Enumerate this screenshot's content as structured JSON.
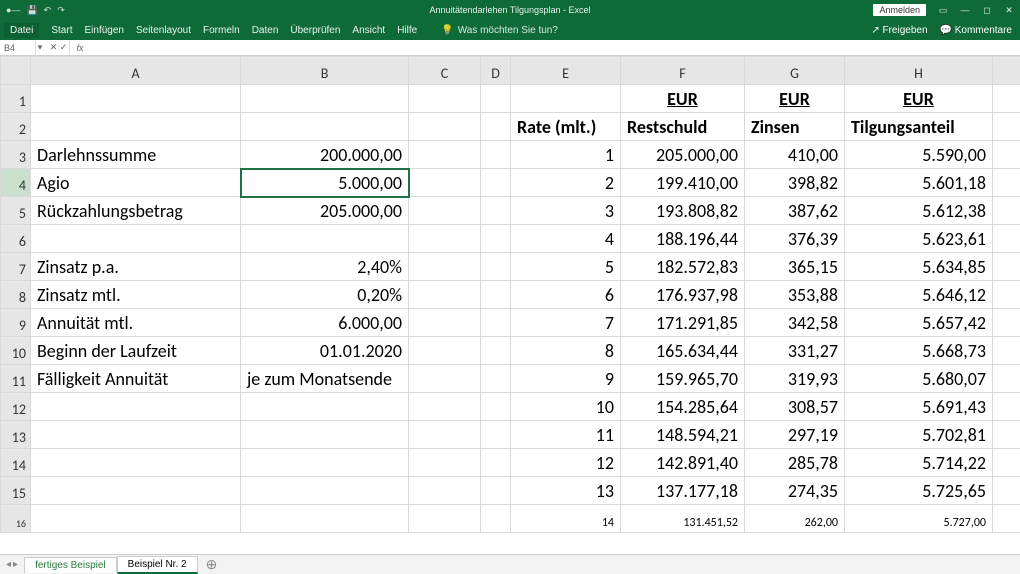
{
  "window": {
    "title": "Annuitätendarlehen Tilgungsplan - Excel",
    "login": "Anmelden",
    "share": "Freigeben",
    "comments": "Kommentare"
  },
  "ribbon": {
    "file": "Datei",
    "tabs": [
      "Start",
      "Einfügen",
      "Seitenlayout",
      "Formeln",
      "Daten",
      "Überprüfen",
      "Ansicht",
      "Hilfe"
    ],
    "tellme_placeholder": "Was möchten Sie tun?"
  },
  "namebox": "B4",
  "columns": [
    "A",
    "B",
    "C",
    "D",
    "E",
    "F",
    "G",
    "H",
    ""
  ],
  "header_row1": {
    "F": "EUR",
    "G": "EUR",
    "H": "EUR"
  },
  "header_row2": {
    "E": "Rate (mlt.)",
    "F": "Restschuld",
    "G": "Zinsen",
    "H": "Tilgungsanteil"
  },
  "left_block": [
    {
      "label": "Darlehnssumme",
      "value": "200.000,00"
    },
    {
      "label": "Agio",
      "value": "5.000,00"
    },
    {
      "label": "Rückzahlungsbetrag",
      "value": "205.000,00"
    },
    {
      "label": "",
      "value": ""
    },
    {
      "label": "Zinsatz p.a.",
      "value": "2,40%"
    },
    {
      "label": "Zinsatz mtl.",
      "value": "0,20%"
    },
    {
      "label": "Annuität mtl.",
      "value": "6.000,00"
    },
    {
      "label": "Beginn der Laufzeit",
      "value": "01.01.2020"
    },
    {
      "label": "Fälligkeit Annuität",
      "value": "je zum Monatsende"
    }
  ],
  "schedule": [
    {
      "rate": "1",
      "rest": "205.000,00",
      "zins": "410,00",
      "tilg": "5.590,00"
    },
    {
      "rate": "2",
      "rest": "199.410,00",
      "zins": "398,82",
      "tilg": "5.601,18"
    },
    {
      "rate": "3",
      "rest": "193.808,82",
      "zins": "387,62",
      "tilg": "5.612,38"
    },
    {
      "rate": "4",
      "rest": "188.196,44",
      "zins": "376,39",
      "tilg": "5.623,61"
    },
    {
      "rate": "5",
      "rest": "182.572,83",
      "zins": "365,15",
      "tilg": "5.634,85"
    },
    {
      "rate": "6",
      "rest": "176.937,98",
      "zins": "353,88",
      "tilg": "5.646,12"
    },
    {
      "rate": "7",
      "rest": "171.291,85",
      "zins": "342,58",
      "tilg": "5.657,42"
    },
    {
      "rate": "8",
      "rest": "165.634,44",
      "zins": "331,27",
      "tilg": "5.668,73"
    },
    {
      "rate": "9",
      "rest": "159.965,70",
      "zins": "319,93",
      "tilg": "5.680,07"
    },
    {
      "rate": "10",
      "rest": "154.285,64",
      "zins": "308,57",
      "tilg": "5.691,43"
    },
    {
      "rate": "11",
      "rest": "148.594,21",
      "zins": "297,19",
      "tilg": "5.702,81"
    },
    {
      "rate": "12",
      "rest": "142.891,40",
      "zins": "285,78",
      "tilg": "5.714,22"
    },
    {
      "rate": "13",
      "rest": "137.177,18",
      "zins": "274,35",
      "tilg": "5.725,65"
    }
  ],
  "partial_row": {
    "rate": "14",
    "rest": "131.451,52",
    "zins": "262,00",
    "tilg": "5.727,00"
  },
  "sheets": {
    "s1": "fertiges Beispiel",
    "s2": "Beispiel Nr. 2"
  }
}
